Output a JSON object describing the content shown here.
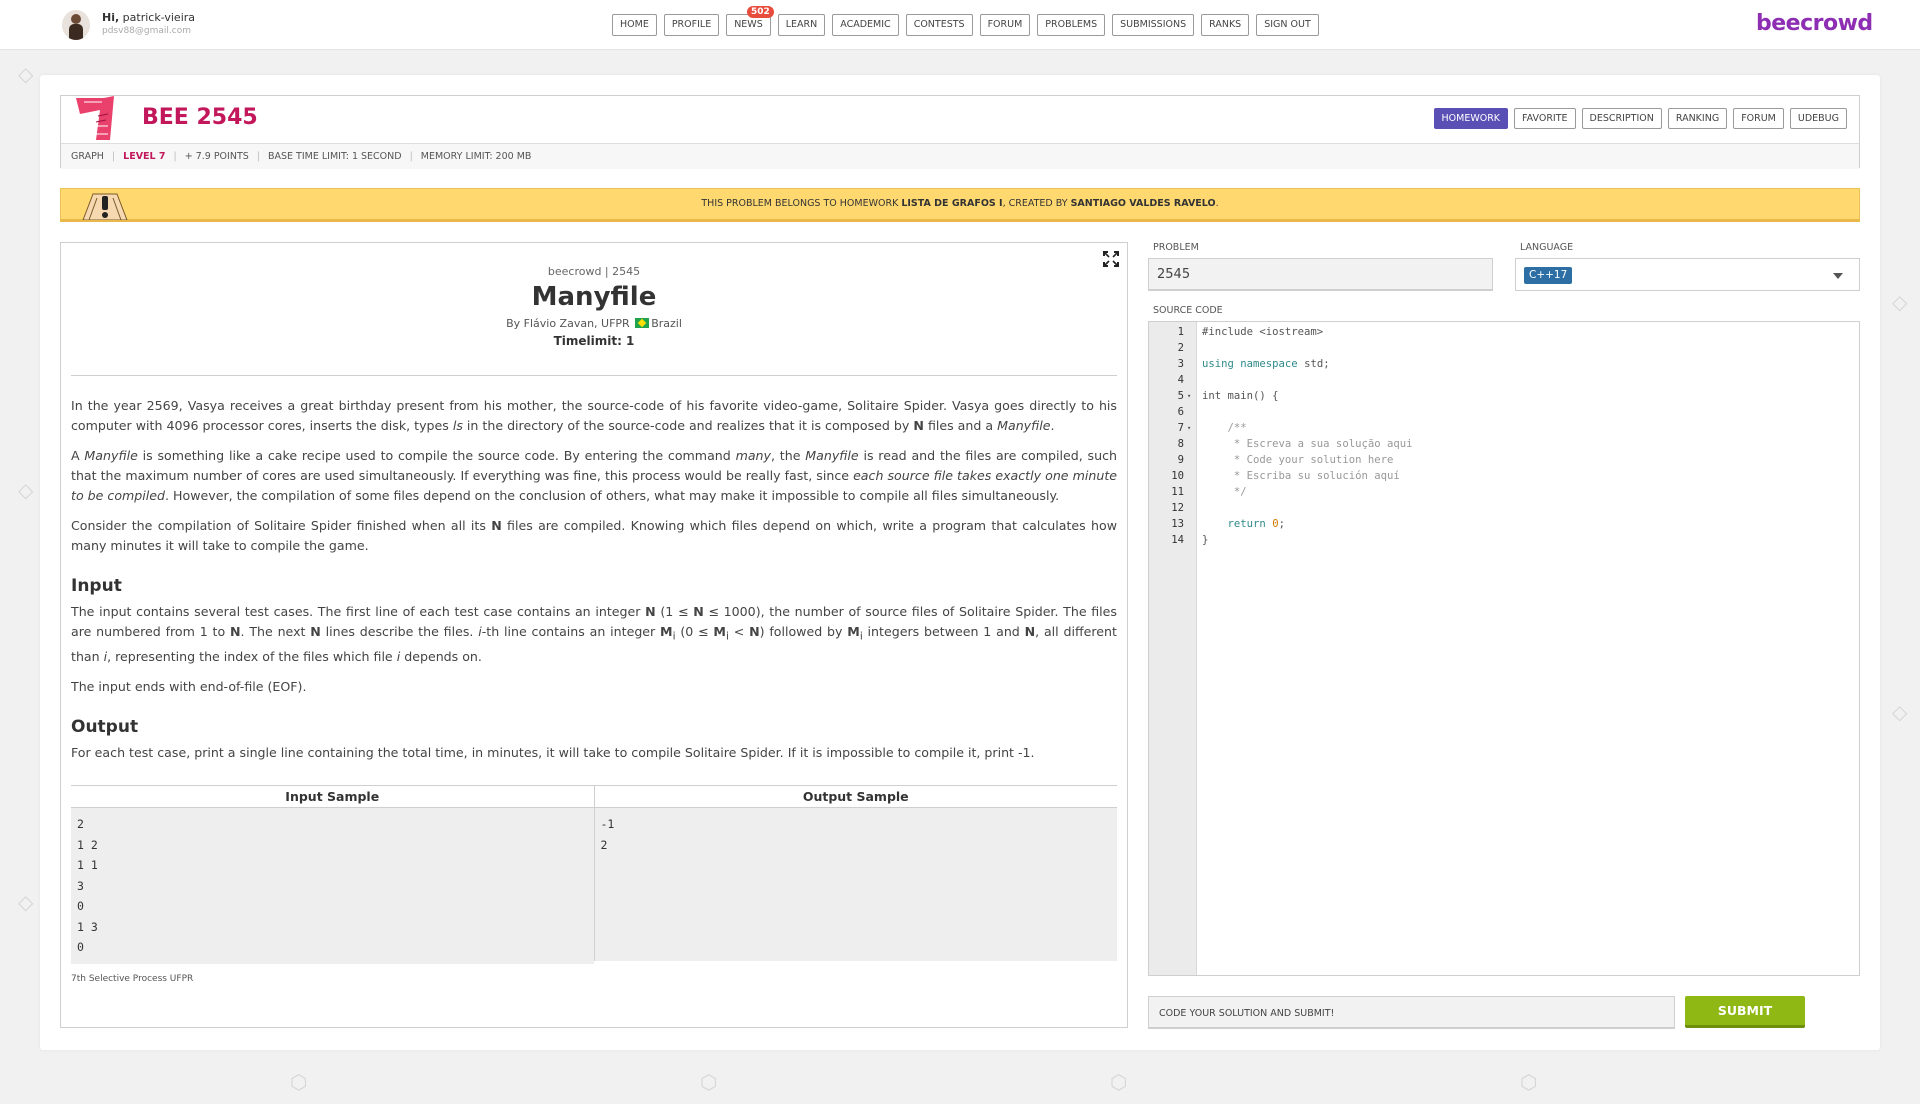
{
  "user": {
    "greeting": "Hi,",
    "name": "patrick-vieira",
    "email": "pdsv88@gmail.com"
  },
  "nav": {
    "items": [
      "HOME",
      "PROFILE",
      "NEWS",
      "LEARN",
      "ACADEMIC",
      "CONTESTS",
      "FORUM",
      "PROBLEMS",
      "SUBMISSIONS",
      "RANKS",
      "SIGN OUT"
    ],
    "news_badge": "502"
  },
  "brand": "beecrowd",
  "problem": {
    "title": "BEE 2545",
    "tabs": [
      "HOMEWORK",
      "FAVORITE",
      "DESCRIPTION",
      "RANKING",
      "FORUM",
      "UDEBUG"
    ],
    "active_tab": "HOMEWORK",
    "category": "GRAPH",
    "level": "LEVEL 7",
    "points": "+ 7.9 POINTS",
    "time_limit": "BASE TIME LIMIT: 1 SECOND",
    "memory_limit": "MEMORY LIMIT: 200 MB"
  },
  "banner": {
    "prefix": "THIS PROBLEM BELONGS TO HOMEWORK",
    "homework": "LISTA DE GRAFOS I",
    "middle": ", CREATED BY",
    "author": "SANTIAGO VALDES RAVELO",
    "suffix": "."
  },
  "statement": {
    "crumb": "beecrowd | 2545",
    "name": "Manyfile",
    "author_prefix": "By Flávio Zavan, UFPR",
    "country": "Brazil",
    "timelimit": "Timelimit: 1",
    "p1_a": "In the year 2569, Vasya receives a great birthday present from his mother, the source-code of his favorite video-game, Solitaire Spider. Vasya goes directly to his computer with 4096 processor cores, inserts the disk, types ",
    "p1_ls": "ls",
    "p1_b": " in the directory of the source-code and realizes that it is composed by ",
    "p1_n": "N",
    "p1_c": " files and a ",
    "p1_manyfile": "Manyfile",
    "p1_d": ".",
    "p2_a": "A ",
    "p2_manyfile": "Manyfile",
    "p2_b": " is something like a cake recipe used to compile the source code. By entering the command ",
    "p2_many": "many",
    "p2_c": ", the ",
    "p2_manyfile2": "Manyfile",
    "p2_d": " is read and the files are compiled, such that the maximum number of cores are used simultaneously. If everything was fine, this process would be really fast, since ",
    "p2_italic": "each source file takes exactly one minute to be compiled",
    "p2_e": ". However, the compilation of some files depend on the conclusion of others, what may make it impossible to compile all files simultaneously.",
    "p3_a": "Consider the compilation of Solitaire Spider finished when all its ",
    "p3_n": "N",
    "p3_b": " files are compiled. Knowing which files depend on which, write a program that calculates how many minutes it will take to compile the game.",
    "input_title": "Input",
    "in1_a": "The input contains several test cases. The first line of each test case contains an integer ",
    "in1_n": "N",
    "in1_b": " (1 ≤ ",
    "in1_n2": "N",
    "in1_c": " ≤ 1000), the number of source files of Solitaire Spider. The files are numbered from 1 to ",
    "in1_n3": "N",
    "in1_d": ". The next ",
    "in1_n4": "N",
    "in1_e": " lines describe the files. ",
    "in1_i": "i",
    "in1_f": "-th line contains an integer ",
    "in1_m": "M",
    "in1_sub_i": "i",
    "in1_g": " (0 ≤ ",
    "in1_m2": "M",
    "in1_sub_i2": "i",
    "in1_h": " < ",
    "in1_n5": "N",
    "in1_j": ") followed by ",
    "in1_m3": "M",
    "in1_sub_i3": "i",
    "in1_k": " integers between 1 and ",
    "in1_n6": "N",
    "in1_l": ", all different than ",
    "in1_i2": "i",
    "in1_m_end": ", representing the index of the files which file ",
    "in1_i3": "i",
    "in1_o": " depends on.",
    "in2": "The input ends with end-of-file (EOF).",
    "output_title": "Output",
    "out1": "For each test case, print a single line containing the total time, in minutes, it will take to compile Solitaire Spider. If it is impossible to compile it, print -1.",
    "samples_input_label": "Input Sample",
    "samples_output_label": "Output Sample",
    "sample_input": "2\n1 2\n1 1\n3\n0\n1 3\n0",
    "sample_output": "-1\n2",
    "source_note": "7th Selective Process UFPR"
  },
  "editor": {
    "problem_label": "PROBLEM",
    "problem_value": "2545",
    "language_label": "LANGUAGE",
    "language_value": "C++17",
    "source_label": "SOURCE CODE",
    "lines": [
      {
        "n": "1",
        "fold": "",
        "t": "#include <iostream>",
        "cls": ""
      },
      {
        "n": "2",
        "fold": "",
        "t": "",
        "cls": ""
      },
      {
        "n": "3",
        "fold": "",
        "t": "using namespace std;",
        "cls": "using"
      },
      {
        "n": "4",
        "fold": "",
        "t": "",
        "cls": ""
      },
      {
        "n": "5",
        "fold": "▾",
        "t": "int main() {",
        "cls": ""
      },
      {
        "n": "6",
        "fold": "",
        "t": "",
        "cls": ""
      },
      {
        "n": "7",
        "fold": "▾",
        "t": "    /**",
        "cls": "comment"
      },
      {
        "n": "8",
        "fold": "",
        "t": "     * Escreva a sua solução aqui",
        "cls": "comment"
      },
      {
        "n": "9",
        "fold": "",
        "t": "     * Code your solution here",
        "cls": "comment"
      },
      {
        "n": "10",
        "fold": "",
        "t": "     * Escriba su solución aquí",
        "cls": "comment"
      },
      {
        "n": "11",
        "fold": "",
        "t": "     */",
        "cls": "comment"
      },
      {
        "n": "12",
        "fold": "",
        "t": "",
        "cls": ""
      },
      {
        "n": "13",
        "fold": "",
        "t": "    return 0;",
        "cls": "return"
      },
      {
        "n": "14",
        "fold": "",
        "t": "}",
        "cls": ""
      }
    ],
    "submit_message": "CODE YOUR SOLUTION AND SUBMIT!",
    "submit_label": "SUBMIT"
  },
  "colors": {
    "brand": "#8e2fb3",
    "title": "#c2185b",
    "active_tab": "#5a4fb5",
    "banner": "#ffd970",
    "submit": "#8fb814",
    "language_chip": "#2d6fa4"
  }
}
